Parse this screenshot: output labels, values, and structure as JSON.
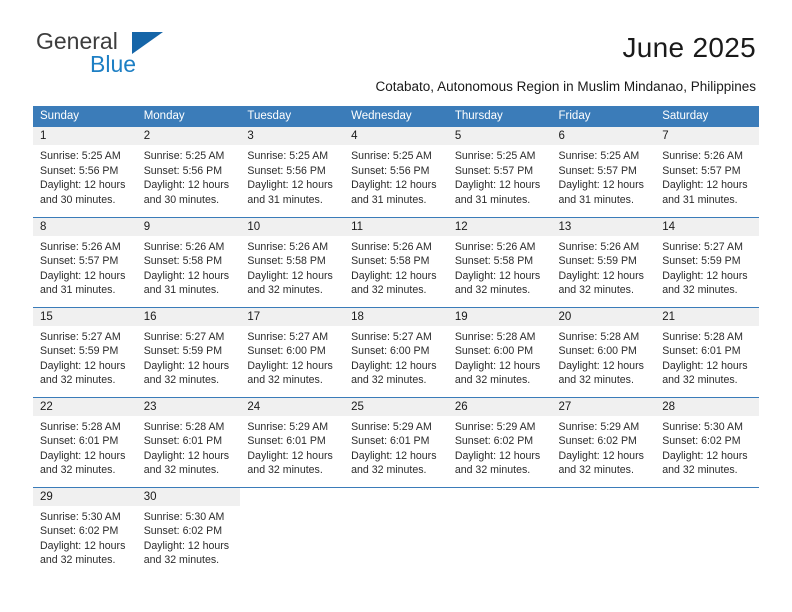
{
  "brand": {
    "name_part1": "General",
    "name_part2": "Blue",
    "triangle_color": "#1565a8",
    "blue_text_color": "#1d7fc4"
  },
  "header": {
    "title": "June 2025",
    "subtitle": "Cotabato, Autonomous Region in Muslim Mindanao, Philippines"
  },
  "theme": {
    "header_bg": "#3b7cb9",
    "header_text": "#ffffff",
    "datenum_bg": "#f0f0f0",
    "rule_color": "#3b7cb9"
  },
  "weekdays": [
    "Sunday",
    "Monday",
    "Tuesday",
    "Wednesday",
    "Thursday",
    "Friday",
    "Saturday"
  ],
  "weeks": [
    [
      {
        "day": "1",
        "sunrise": "Sunrise: 5:25 AM",
        "sunset": "Sunset: 5:56 PM",
        "daylight1": "Daylight: 12 hours",
        "daylight2": "and 30 minutes."
      },
      {
        "day": "2",
        "sunrise": "Sunrise: 5:25 AM",
        "sunset": "Sunset: 5:56 PM",
        "daylight1": "Daylight: 12 hours",
        "daylight2": "and 30 minutes."
      },
      {
        "day": "3",
        "sunrise": "Sunrise: 5:25 AM",
        "sunset": "Sunset: 5:56 PM",
        "daylight1": "Daylight: 12 hours",
        "daylight2": "and 31 minutes."
      },
      {
        "day": "4",
        "sunrise": "Sunrise: 5:25 AM",
        "sunset": "Sunset: 5:56 PM",
        "daylight1": "Daylight: 12 hours",
        "daylight2": "and 31 minutes."
      },
      {
        "day": "5",
        "sunrise": "Sunrise: 5:25 AM",
        "sunset": "Sunset: 5:57 PM",
        "daylight1": "Daylight: 12 hours",
        "daylight2": "and 31 minutes."
      },
      {
        "day": "6",
        "sunrise": "Sunrise: 5:25 AM",
        "sunset": "Sunset: 5:57 PM",
        "daylight1": "Daylight: 12 hours",
        "daylight2": "and 31 minutes."
      },
      {
        "day": "7",
        "sunrise": "Sunrise: 5:26 AM",
        "sunset": "Sunset: 5:57 PM",
        "daylight1": "Daylight: 12 hours",
        "daylight2": "and 31 minutes."
      }
    ],
    [
      {
        "day": "8",
        "sunrise": "Sunrise: 5:26 AM",
        "sunset": "Sunset: 5:57 PM",
        "daylight1": "Daylight: 12 hours",
        "daylight2": "and 31 minutes."
      },
      {
        "day": "9",
        "sunrise": "Sunrise: 5:26 AM",
        "sunset": "Sunset: 5:58 PM",
        "daylight1": "Daylight: 12 hours",
        "daylight2": "and 31 minutes."
      },
      {
        "day": "10",
        "sunrise": "Sunrise: 5:26 AM",
        "sunset": "Sunset: 5:58 PM",
        "daylight1": "Daylight: 12 hours",
        "daylight2": "and 32 minutes."
      },
      {
        "day": "11",
        "sunrise": "Sunrise: 5:26 AM",
        "sunset": "Sunset: 5:58 PM",
        "daylight1": "Daylight: 12 hours",
        "daylight2": "and 32 minutes."
      },
      {
        "day": "12",
        "sunrise": "Sunrise: 5:26 AM",
        "sunset": "Sunset: 5:58 PM",
        "daylight1": "Daylight: 12 hours",
        "daylight2": "and 32 minutes."
      },
      {
        "day": "13",
        "sunrise": "Sunrise: 5:26 AM",
        "sunset": "Sunset: 5:59 PM",
        "daylight1": "Daylight: 12 hours",
        "daylight2": "and 32 minutes."
      },
      {
        "day": "14",
        "sunrise": "Sunrise: 5:27 AM",
        "sunset": "Sunset: 5:59 PM",
        "daylight1": "Daylight: 12 hours",
        "daylight2": "and 32 minutes."
      }
    ],
    [
      {
        "day": "15",
        "sunrise": "Sunrise: 5:27 AM",
        "sunset": "Sunset: 5:59 PM",
        "daylight1": "Daylight: 12 hours",
        "daylight2": "and 32 minutes."
      },
      {
        "day": "16",
        "sunrise": "Sunrise: 5:27 AM",
        "sunset": "Sunset: 5:59 PM",
        "daylight1": "Daylight: 12 hours",
        "daylight2": "and 32 minutes."
      },
      {
        "day": "17",
        "sunrise": "Sunrise: 5:27 AM",
        "sunset": "Sunset: 6:00 PM",
        "daylight1": "Daylight: 12 hours",
        "daylight2": "and 32 minutes."
      },
      {
        "day": "18",
        "sunrise": "Sunrise: 5:27 AM",
        "sunset": "Sunset: 6:00 PM",
        "daylight1": "Daylight: 12 hours",
        "daylight2": "and 32 minutes."
      },
      {
        "day": "19",
        "sunrise": "Sunrise: 5:28 AM",
        "sunset": "Sunset: 6:00 PM",
        "daylight1": "Daylight: 12 hours",
        "daylight2": "and 32 minutes."
      },
      {
        "day": "20",
        "sunrise": "Sunrise: 5:28 AM",
        "sunset": "Sunset: 6:00 PM",
        "daylight1": "Daylight: 12 hours",
        "daylight2": "and 32 minutes."
      },
      {
        "day": "21",
        "sunrise": "Sunrise: 5:28 AM",
        "sunset": "Sunset: 6:01 PM",
        "daylight1": "Daylight: 12 hours",
        "daylight2": "and 32 minutes."
      }
    ],
    [
      {
        "day": "22",
        "sunrise": "Sunrise: 5:28 AM",
        "sunset": "Sunset: 6:01 PM",
        "daylight1": "Daylight: 12 hours",
        "daylight2": "and 32 minutes."
      },
      {
        "day": "23",
        "sunrise": "Sunrise: 5:28 AM",
        "sunset": "Sunset: 6:01 PM",
        "daylight1": "Daylight: 12 hours",
        "daylight2": "and 32 minutes."
      },
      {
        "day": "24",
        "sunrise": "Sunrise: 5:29 AM",
        "sunset": "Sunset: 6:01 PM",
        "daylight1": "Daylight: 12 hours",
        "daylight2": "and 32 minutes."
      },
      {
        "day": "25",
        "sunrise": "Sunrise: 5:29 AM",
        "sunset": "Sunset: 6:01 PM",
        "daylight1": "Daylight: 12 hours",
        "daylight2": "and 32 minutes."
      },
      {
        "day": "26",
        "sunrise": "Sunrise: 5:29 AM",
        "sunset": "Sunset: 6:02 PM",
        "daylight1": "Daylight: 12 hours",
        "daylight2": "and 32 minutes."
      },
      {
        "day": "27",
        "sunrise": "Sunrise: 5:29 AM",
        "sunset": "Sunset: 6:02 PM",
        "daylight1": "Daylight: 12 hours",
        "daylight2": "and 32 minutes."
      },
      {
        "day": "28",
        "sunrise": "Sunrise: 5:30 AM",
        "sunset": "Sunset: 6:02 PM",
        "daylight1": "Daylight: 12 hours",
        "daylight2": "and 32 minutes."
      }
    ],
    [
      {
        "day": "29",
        "sunrise": "Sunrise: 5:30 AM",
        "sunset": "Sunset: 6:02 PM",
        "daylight1": "Daylight: 12 hours",
        "daylight2": "and 32 minutes."
      },
      {
        "day": "30",
        "sunrise": "Sunrise: 5:30 AM",
        "sunset": "Sunset: 6:02 PM",
        "daylight1": "Daylight: 12 hours",
        "daylight2": "and 32 minutes."
      },
      null,
      null,
      null,
      null,
      null
    ]
  ]
}
